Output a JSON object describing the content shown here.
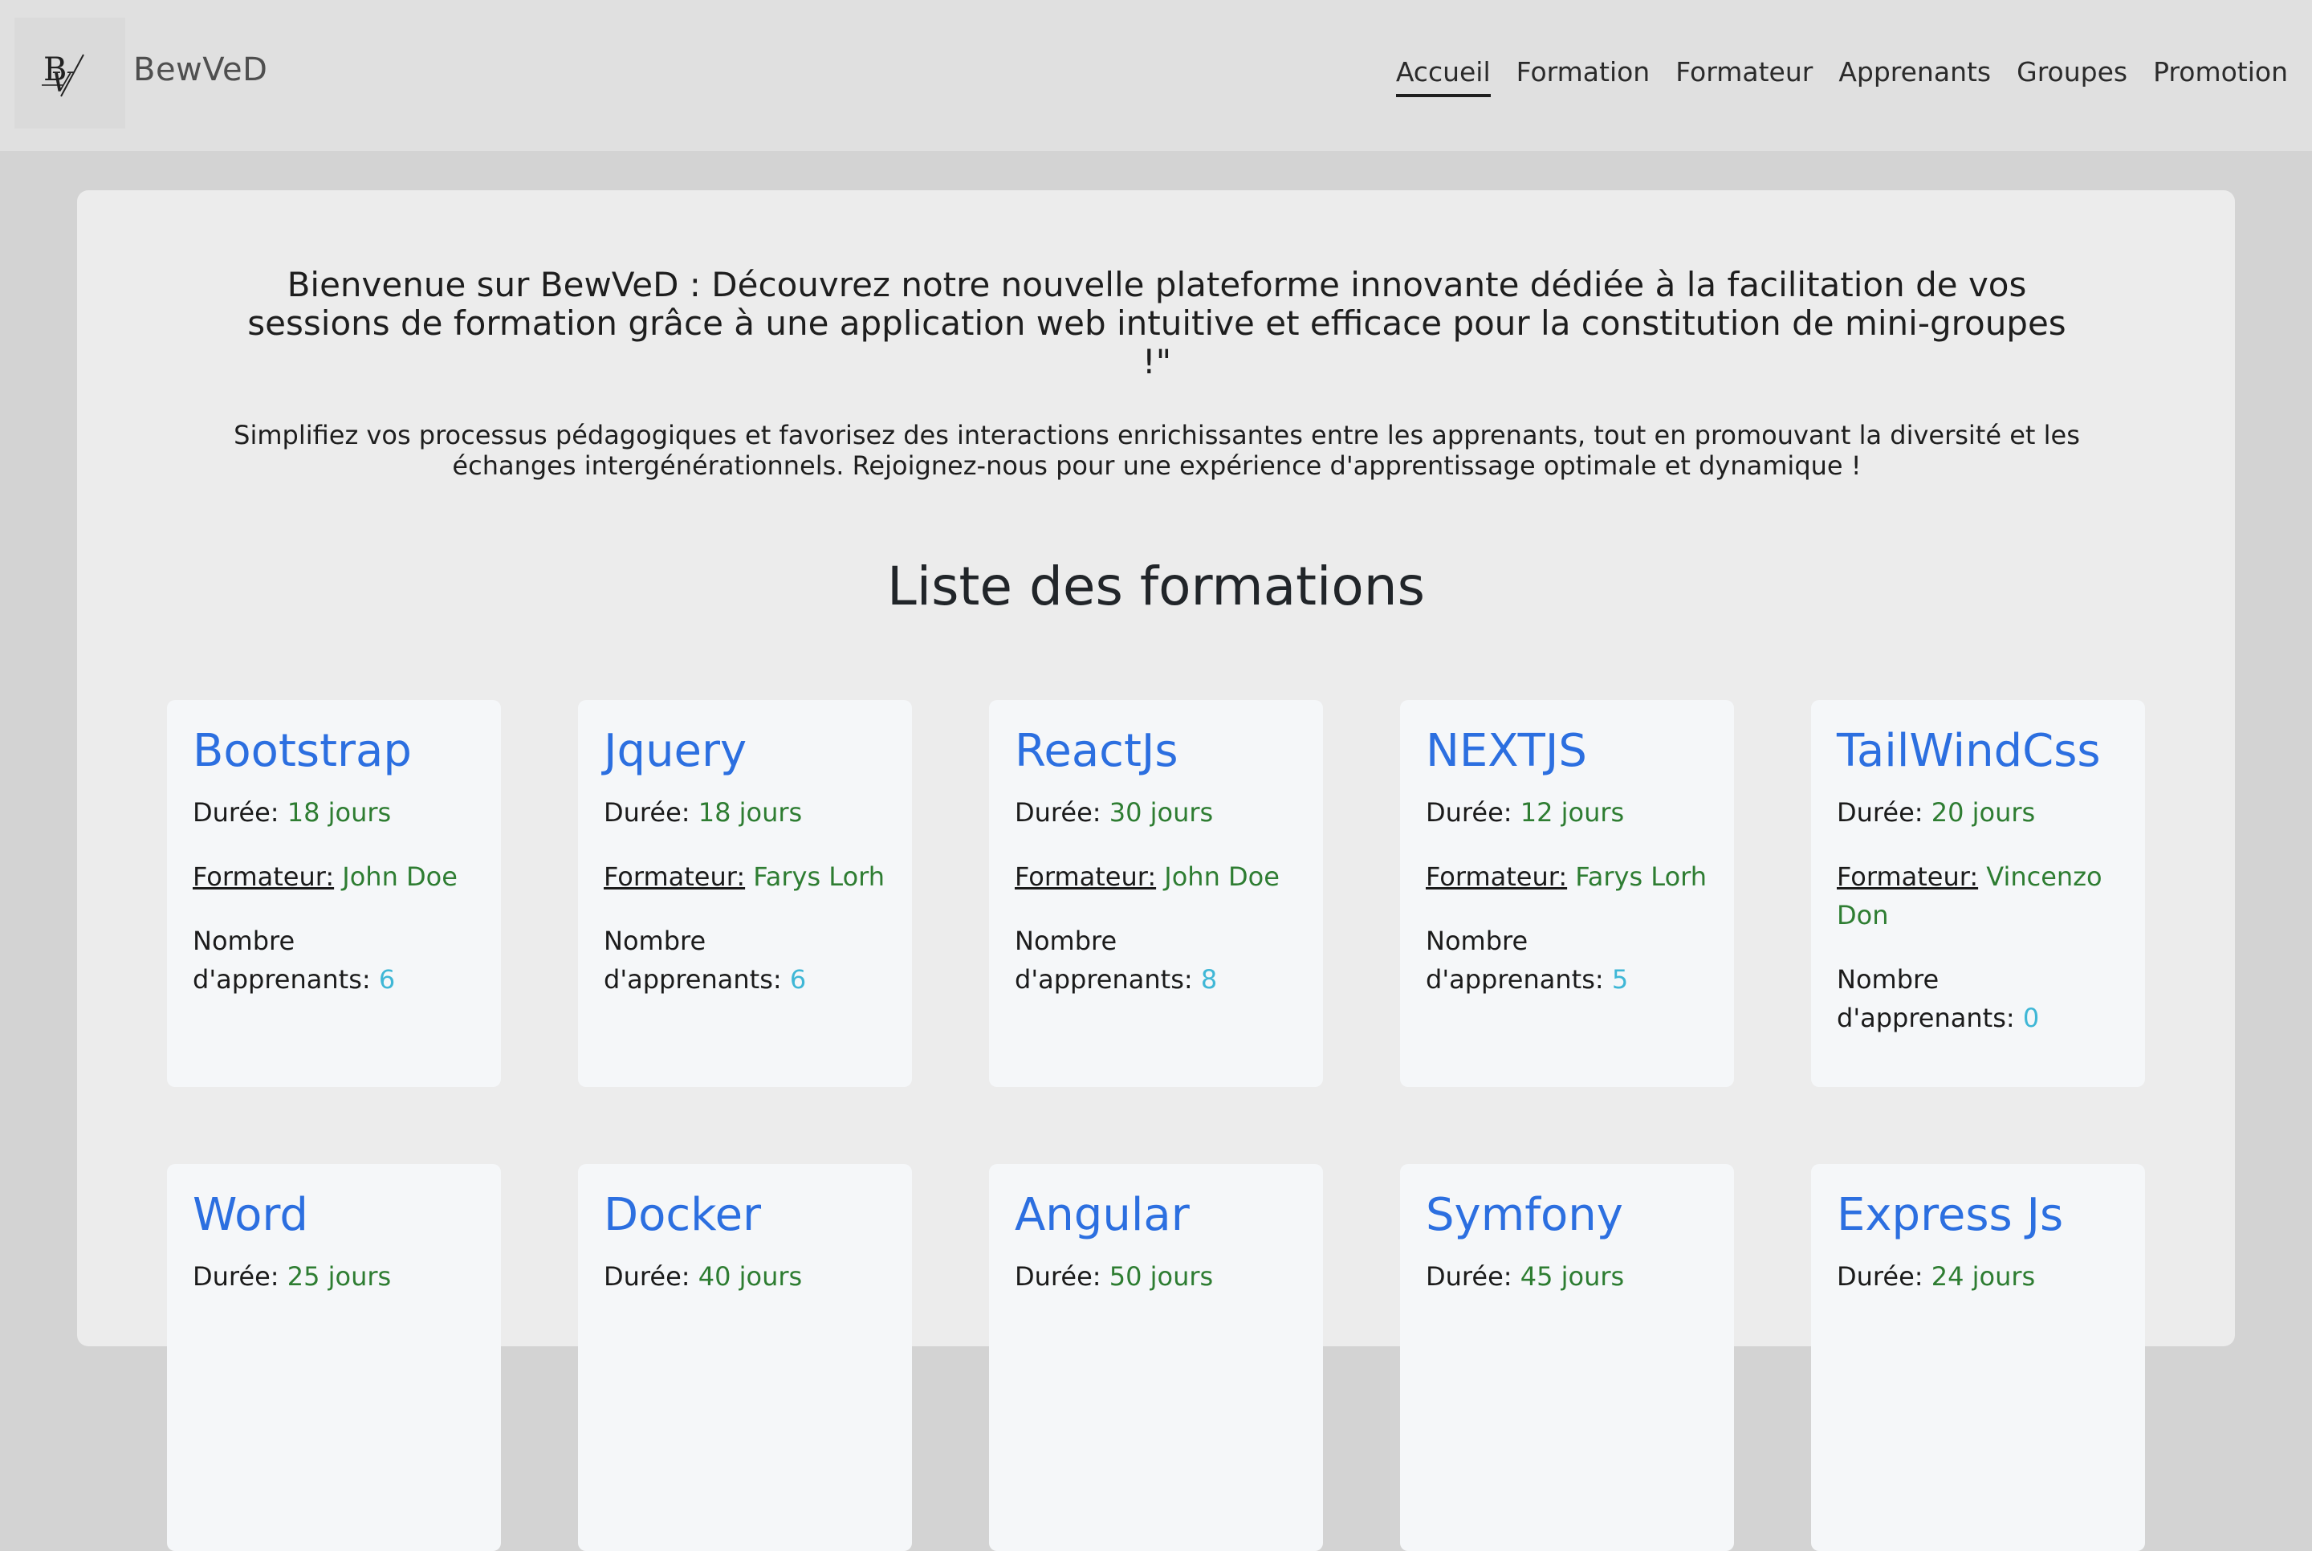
{
  "brand": {
    "name": "BewVeD",
    "logo_icon": "bv-logo-icon"
  },
  "nav": {
    "items": [
      {
        "label": "Accueil",
        "active": true
      },
      {
        "label": "Formation",
        "active": false
      },
      {
        "label": "Formateur",
        "active": false
      },
      {
        "label": "Apprenants",
        "active": false
      },
      {
        "label": "Groupes",
        "active": false
      },
      {
        "label": "Promotion",
        "active": false
      }
    ]
  },
  "hero": {
    "welcome": "Bienvenue sur BewVeD : Découvrez notre nouvelle plateforme innovante dédiée à la facilitation de vos sessions de formation grâce à une application web intuitive et efficace pour la constitution de mini-groupes !\"",
    "intro": "Simplifiez vos processus pédagogiques et favorisez des interactions enrichissantes entre les apprenants, tout en promouvant la diversité et les échanges intergénérationnels. Rejoignez-nous pour une expérience d'apprentissage optimale et dynamique !"
  },
  "formations": {
    "title": "Liste des formations",
    "labels": {
      "duree": "Durée:",
      "formateur": "Formateur:",
      "nombre": "Nombre d'apprenants:"
    },
    "items": [
      {
        "name": "Bootstrap",
        "duree": "18 jours",
        "formateur": "John Doe",
        "apprenants": "6"
      },
      {
        "name": "Jquery",
        "duree": "18 jours",
        "formateur": "Farys Lorh",
        "apprenants": "6"
      },
      {
        "name": "ReactJs",
        "duree": "30 jours",
        "formateur": "John Doe",
        "apprenants": "8"
      },
      {
        "name": "NEXTJS",
        "duree": "12 jours",
        "formateur": "Farys Lorh",
        "apprenants": "5"
      },
      {
        "name": "TailWindCss",
        "duree": "20 jours",
        "formateur": "Vincenzo Don",
        "apprenants": "0"
      },
      {
        "name": "Word",
        "duree": "25 jours"
      },
      {
        "name": "Docker",
        "duree": "40 jours"
      },
      {
        "name": "Angular",
        "duree": "50 jours"
      },
      {
        "name": "Symfony",
        "duree": "45 jours"
      },
      {
        "name": "Express Js",
        "duree": "24 jours"
      }
    ]
  },
  "colors": {
    "accent_blue": "#2c6fe0",
    "value_green": "#2e7d32",
    "count_teal": "#3fb7d6"
  }
}
